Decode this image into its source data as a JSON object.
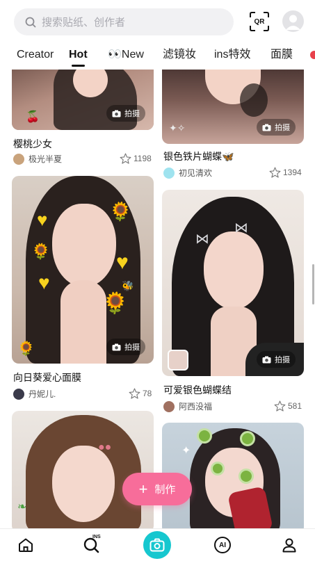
{
  "search": {
    "placeholder": "搜索贴纸、创作者",
    "icon": "search-icon"
  },
  "topbar": {
    "qr_label": "QR"
  },
  "tabs": [
    {
      "label": "Creator"
    },
    {
      "label": "Hot"
    },
    {
      "label": "👀New"
    },
    {
      "label": "滤镜妆"
    },
    {
      "label": "ins特效"
    },
    {
      "label": "面膜"
    }
  ],
  "active_tab": "Hot",
  "shoot_label": "拍摄",
  "cards": [
    {
      "title": "樱桃少女",
      "author": "极光半夏",
      "likes": "1198"
    },
    {
      "title": "银色铁片蝴蝶🦋",
      "author": "初见清欢",
      "likes": "1394"
    },
    {
      "title": "向日葵爱心面膜",
      "author": "丹妮儿.",
      "likes": "78"
    },
    {
      "title": "可爱银色蝴蝶结",
      "author": "阿西没福",
      "likes": "581"
    }
  ],
  "fab": {
    "label": "制作"
  },
  "bottom_nav": {
    "home_icon": "home-icon",
    "ins_icon": "ins-search-icon",
    "camera_icon": "camera-icon",
    "ai_label": "AI",
    "profile_icon": "profile-icon",
    "ins_label": "INS"
  },
  "colors": {
    "accent_pink": "#f76d9a",
    "camera_teal": "#16c7cf"
  }
}
